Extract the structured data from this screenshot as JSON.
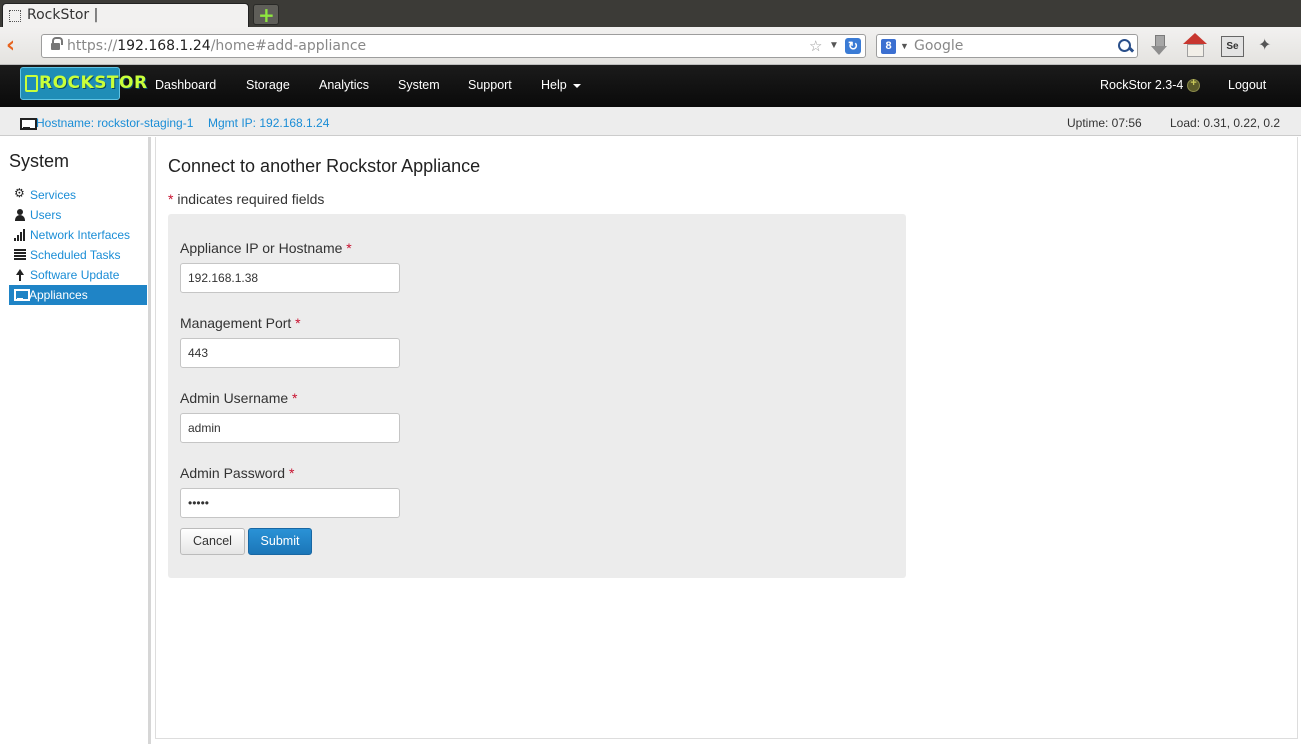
{
  "browser": {
    "tab_title": "RockStor |",
    "new_tab_glyph": "+",
    "url_scheme": "https://",
    "url_host": "192.168.1.24",
    "url_path": "/home#add-appliance",
    "search_engine_glyph": "8",
    "search_placeholder": "Google"
  },
  "app_nav": {
    "logo_text": "ROCKSTOR",
    "items": [
      {
        "label": "Dashboard"
      },
      {
        "label": "Storage"
      },
      {
        "label": "Analytics"
      },
      {
        "label": "System"
      },
      {
        "label": "Support"
      },
      {
        "label": "Help"
      }
    ],
    "version": "RockStor 2.3-4",
    "logout": "Logout"
  },
  "status": {
    "hostname": "Hostname: rockstor-staging-1",
    "mgmt_ip": "Mgmt IP: 192.168.1.24",
    "uptime": "Uptime: 07:56",
    "load": "Load: 0.31, 0.22, 0.2"
  },
  "sidebar": {
    "title": "System",
    "items": [
      {
        "label": "Services",
        "icon": "gear-icon"
      },
      {
        "label": "Users",
        "icon": "user-icon"
      },
      {
        "label": "Network Interfaces",
        "icon": "signal-icon"
      },
      {
        "label": "Scheduled Tasks",
        "icon": "tasks-icon"
      },
      {
        "label": "Software Update",
        "icon": "arrow-up-icon"
      },
      {
        "label": "Appliances",
        "icon": "monitor-icon",
        "active": true
      }
    ]
  },
  "main": {
    "title": "Connect to another Rockstor Appliance",
    "required_star": "*",
    "required_note": " indicates required fields",
    "form": {
      "ip_label": "Appliance IP or Hostname ",
      "ip_value": "192.168.1.38",
      "port_label": "Management Port ",
      "port_value": "443",
      "username_label": "Admin Username ",
      "username_value": "admin",
      "password_label": "Admin Password ",
      "password_value": "•••••",
      "cancel_label": "Cancel",
      "submit_label": "Submit"
    }
  },
  "colors": {
    "link": "#1a8dd6",
    "active_bg": "#1f84c6",
    "navbar_bg": "#111111",
    "required": "#c8102e",
    "submit": "#2187c9"
  }
}
